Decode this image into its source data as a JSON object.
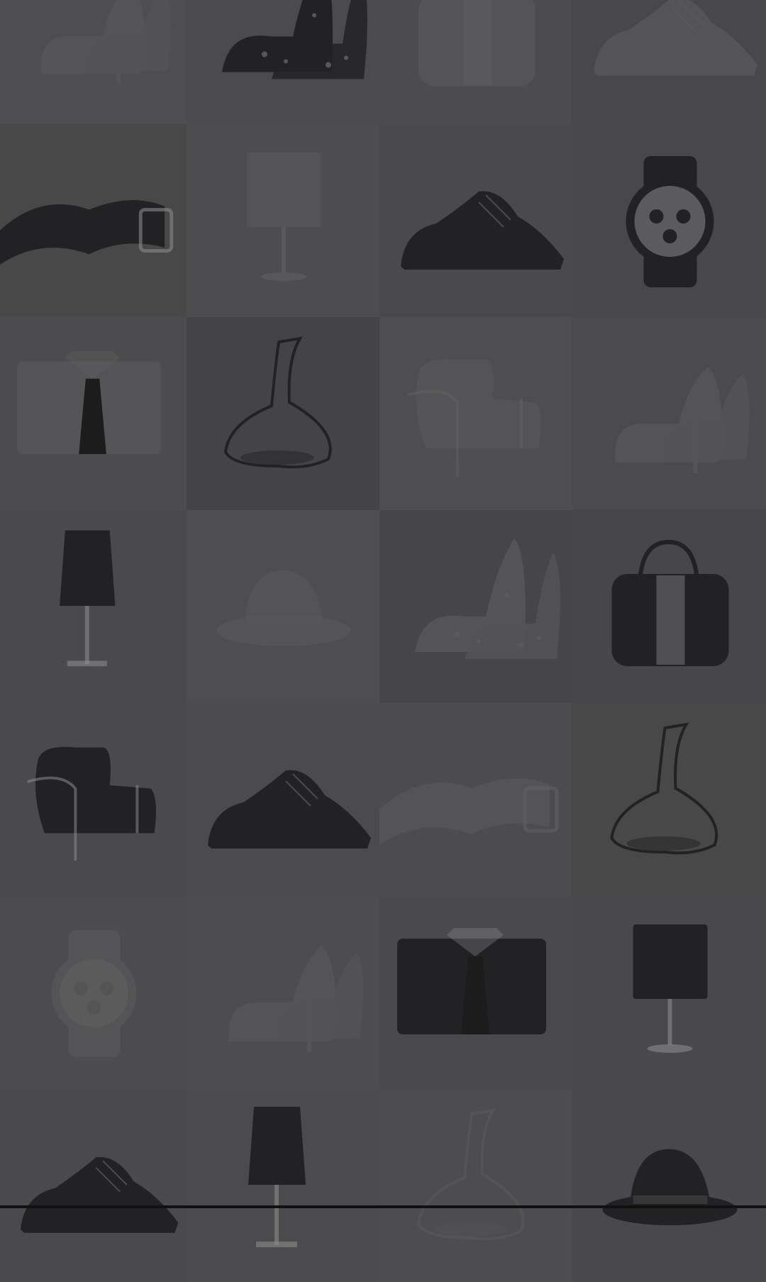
{
  "page": {
    "overlay_color": "#4a4a4c"
  },
  "gallery": {
    "tiles": [
      {
        "item": "pumps",
        "shade": "#4e4e50",
        "dim": true
      },
      {
        "item": "leopard-heels",
        "shade": "#4b4b4d",
        "dim": false
      },
      {
        "item": "handbag",
        "shade": "#4c4c4e",
        "dim": true
      },
      {
        "item": "oxford-shoes",
        "shade": "#48484a",
        "dim": true
      },
      {
        "item": "belt",
        "shade": "#484849",
        "dim": false
      },
      {
        "item": "table-lamp",
        "shade": "#4d4d4f",
        "dim": true
      },
      {
        "item": "oxford-shoes",
        "shade": "#4a4a4c",
        "dim": false
      },
      {
        "item": "wristwatch",
        "shade": "#48484a",
        "dim": false
      },
      {
        "item": "shirt-and-tie",
        "shade": "#4c4c4e",
        "dim": true
      },
      {
        "item": "carafe",
        "shade": "#444446",
        "dim": false
      },
      {
        "item": "armchair",
        "shade": "#4e4e50",
        "dim": true
      },
      {
        "item": "pumps",
        "shade": "#4b4b4d",
        "dim": true
      },
      {
        "item": "tall-lamp",
        "shade": "#4a4a4c",
        "dim": false
      },
      {
        "item": "fedora",
        "shade": "#4e4e50",
        "dim": true
      },
      {
        "item": "leopard-heels",
        "shade": "#464648",
        "dim": true
      },
      {
        "item": "handbag",
        "shade": "#474749",
        "dim": false
      },
      {
        "item": "armchair",
        "shade": "#4a4a4c",
        "dim": false
      },
      {
        "item": "oxford-shoes",
        "shade": "#4b4b4d",
        "dim": false
      },
      {
        "item": "belt",
        "shade": "#4c4c4e",
        "dim": true
      },
      {
        "item": "carafe",
        "shade": "#484849",
        "dim": false
      },
      {
        "item": "wristwatch",
        "shade": "#4c4c4e",
        "dim": true
      },
      {
        "item": "pumps",
        "shade": "#4d4d4f",
        "dim": true
      },
      {
        "item": "shirt-and-tie",
        "shade": "#4a4a4c",
        "dim": false
      },
      {
        "item": "table-lamp",
        "shade": "#49494b",
        "dim": false
      },
      {
        "item": "oxford-shoes",
        "shade": "#4a4a4c",
        "dim": false
      },
      {
        "item": "tall-lamp",
        "shade": "#4b4b4d",
        "dim": false
      },
      {
        "item": "carafe",
        "shade": "#4d4d4f",
        "dim": true
      },
      {
        "item": "fedora",
        "shade": "#49494b",
        "dim": false
      }
    ]
  }
}
